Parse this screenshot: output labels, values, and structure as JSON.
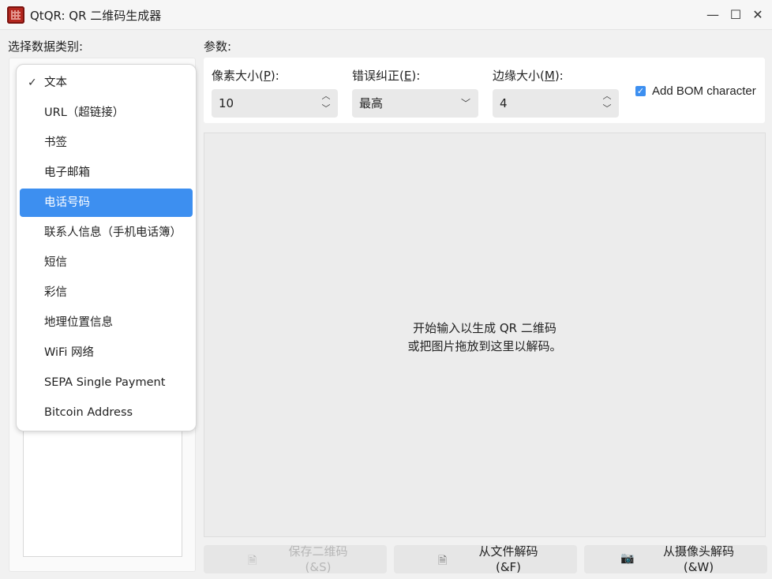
{
  "window": {
    "title": "QtQR: QR 二维码生成器",
    "minimize_glyph": "—",
    "maximize_glyph": "☐",
    "close_glyph": "✕"
  },
  "labels": {
    "data_type": "选择数据类别:",
    "params": "参数:"
  },
  "data_types": {
    "selected_index": 4,
    "checked_index": 0,
    "items": [
      "文本",
      "URL（超链接）",
      "书签",
      "电子邮箱",
      "电话号码",
      "联系人信息（手机电话簿）",
      "短信",
      "彩信",
      "地理位置信息",
      "WiFi 网络",
      "SEPA Single Payment",
      "Bitcoin Address"
    ]
  },
  "params": {
    "pixel_size": {
      "label_pre": "像素大小(",
      "mnemonic": "P",
      "label_post": "):",
      "value": "10"
    },
    "error_correction": {
      "label_pre": "错误纠正(",
      "mnemonic": "E",
      "label_post": "):",
      "value": "最高"
    },
    "margin_size": {
      "label_pre": "边缘大小(",
      "mnemonic": "M",
      "label_post": "):",
      "value": "4"
    },
    "add_bom": {
      "label": "Add BOM character",
      "checked": true
    }
  },
  "preview": {
    "line1": "开始输入以生成 QR 二维码",
    "line2": "或把图片拖放到这里以解码。"
  },
  "buttons": {
    "save": {
      "line1": "保存二维码",
      "line2": "(&S)",
      "enabled": false,
      "icon": "document-icon"
    },
    "decode_file": {
      "line1": "从文件解码",
      "line2": "(&F)",
      "enabled": true,
      "icon": "image-file-icon"
    },
    "decode_camera": {
      "line1": "从摄像头解码",
      "line2": "(&W)",
      "enabled": true,
      "icon": "camera-icon"
    }
  },
  "colors": {
    "accent": "#3d8ff0"
  }
}
